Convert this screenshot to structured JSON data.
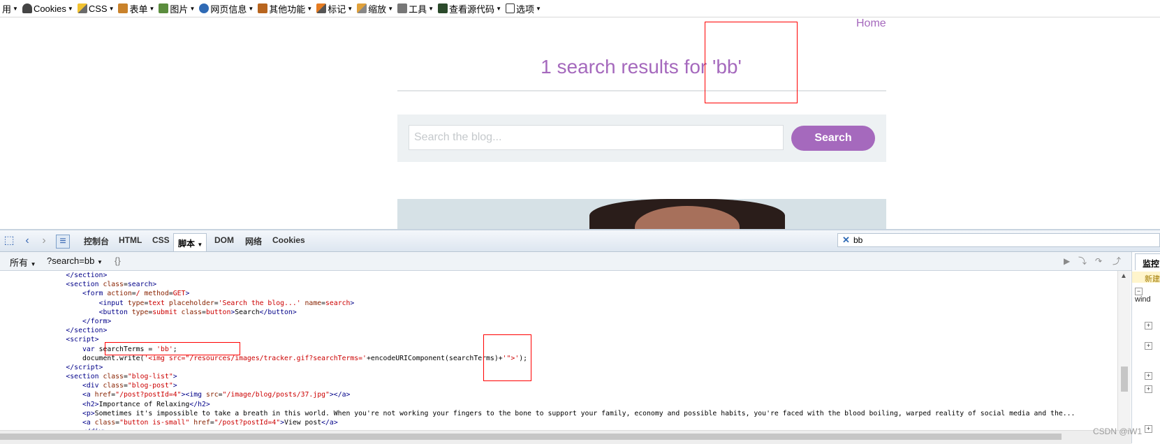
{
  "toolbar": {
    "items": [
      {
        "label": "用",
        "icon": "cut-off-icon"
      },
      {
        "label": "Cookies",
        "icon": "cookie-icon"
      },
      {
        "label": "CSS",
        "icon": "pencil-icon"
      },
      {
        "label": "表单",
        "icon": "form-icon"
      },
      {
        "label": "图片",
        "icon": "image-icon"
      },
      {
        "label": "网页信息",
        "icon": "info-icon"
      },
      {
        "label": "其他功能",
        "icon": "book-icon"
      },
      {
        "label": "标记",
        "icon": "marker-icon"
      },
      {
        "label": "缩放",
        "icon": "resize-icon"
      },
      {
        "label": "工具",
        "icon": "tools-icon"
      },
      {
        "label": "查看源代码",
        "icon": "source-icon"
      },
      {
        "label": "选项",
        "icon": "options-icon"
      }
    ]
  },
  "page": {
    "home": "Home",
    "results_title": "1 search results for 'bb'",
    "search_placeholder": "Search the blog...",
    "search_button": "Search"
  },
  "devtools": {
    "tabs": [
      "控制台",
      "HTML",
      "CSS",
      "DOM",
      "网络",
      "Cookies"
    ],
    "active_tab": "脚本",
    "search_value": "bb",
    "sub_all": "所有",
    "sub_file": "?search=bb",
    "sub_braces": "{}",
    "side_tab": "监控",
    "side_new": "新建",
    "side_window": "wind"
  },
  "watermark": "CSDN @iW1"
}
